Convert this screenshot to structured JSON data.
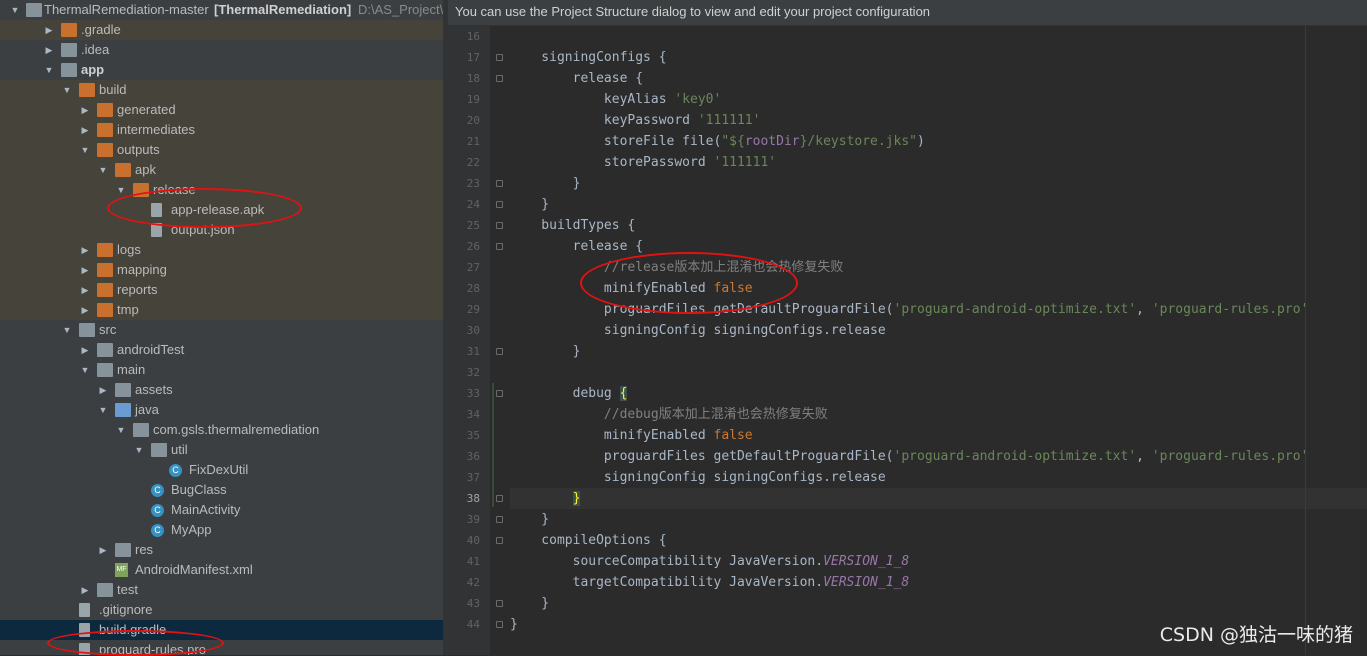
{
  "tree": {
    "root_label": "ThermalRemediation-master",
    "root_module": "[ThermalRemediation]",
    "root_path": "D:\\AS_Project\\F",
    "items": [
      {
        "label": "ThermalRemediation-master",
        "depth": 0,
        "arrow": "down",
        "icon": "folder-g"
      },
      {
        "label": ".gradle",
        "depth": 1,
        "arrow": "right",
        "icon": "folder-o"
      },
      {
        "label": ".idea",
        "depth": 1,
        "arrow": "right",
        "icon": "folder-g"
      },
      {
        "label": "app",
        "depth": 1,
        "arrow": "down",
        "icon": "folder-g",
        "bold": true
      },
      {
        "label": "build",
        "depth": 2,
        "arrow": "down",
        "icon": "folder-o"
      },
      {
        "label": "generated",
        "depth": 3,
        "arrow": "right",
        "icon": "folder-o"
      },
      {
        "label": "intermediates",
        "depth": 3,
        "arrow": "right",
        "icon": "folder-o"
      },
      {
        "label": "outputs",
        "depth": 3,
        "arrow": "down",
        "icon": "folder-o"
      },
      {
        "label": "apk",
        "depth": 4,
        "arrow": "down",
        "icon": "folder-o"
      },
      {
        "label": "release",
        "depth": 5,
        "arrow": "down",
        "icon": "folder-o"
      },
      {
        "label": "app-release.apk",
        "depth": 6,
        "arrow": "none",
        "icon": "file"
      },
      {
        "label": "output.json",
        "depth": 6,
        "arrow": "none",
        "icon": "file"
      },
      {
        "label": "logs",
        "depth": 3,
        "arrow": "right",
        "icon": "folder-o"
      },
      {
        "label": "mapping",
        "depth": 3,
        "arrow": "right",
        "icon": "folder-o"
      },
      {
        "label": "reports",
        "depth": 3,
        "arrow": "right",
        "icon": "folder-o"
      },
      {
        "label": "tmp",
        "depth": 3,
        "arrow": "right",
        "icon": "folder-o"
      },
      {
        "label": "src",
        "depth": 2,
        "arrow": "down",
        "icon": "folder-g"
      },
      {
        "label": "androidTest",
        "depth": 3,
        "arrow": "right",
        "icon": "folder-g"
      },
      {
        "label": "main",
        "depth": 3,
        "arrow": "down",
        "icon": "folder-g"
      },
      {
        "label": "assets",
        "depth": 4,
        "arrow": "right",
        "icon": "folder-g"
      },
      {
        "label": "java",
        "depth": 4,
        "arrow": "down",
        "icon": "folder-b"
      },
      {
        "label": "com.gsls.thermalremediation",
        "depth": 5,
        "arrow": "down",
        "icon": "folder-g"
      },
      {
        "label": "util",
        "depth": 6,
        "arrow": "down",
        "icon": "folder-g"
      },
      {
        "label": "FixDexUtil",
        "depth": 7,
        "arrow": "none",
        "icon": "class"
      },
      {
        "label": "BugClass",
        "depth": 6,
        "arrow": "none",
        "icon": "class"
      },
      {
        "label": "MainActivity",
        "depth": 6,
        "arrow": "none",
        "icon": "class"
      },
      {
        "label": "MyApp",
        "depth": 6,
        "arrow": "none",
        "icon": "class"
      },
      {
        "label": "res",
        "depth": 4,
        "arrow": "right",
        "icon": "folder-g"
      },
      {
        "label": "AndroidManifest.xml",
        "depth": 4,
        "arrow": "none",
        "icon": "xml"
      },
      {
        "label": "test",
        "depth": 3,
        "arrow": "right",
        "icon": "folder-g"
      },
      {
        "label": ".gitignore",
        "depth": 2,
        "arrow": "none",
        "icon": "file"
      },
      {
        "label": "build.gradle",
        "depth": 2,
        "arrow": "none",
        "icon": "file"
      },
      {
        "label": "proguard-rules.pro",
        "depth": 2,
        "arrow": "none",
        "icon": "file"
      }
    ]
  },
  "banner": "You can use the Project Structure dialog to view and edit your project configuration",
  "editor": {
    "current_line": 38,
    "lines": [
      {
        "n": 16,
        "segs": []
      },
      {
        "n": 17,
        "segs": [
          [
            "    signingConfigs {",
            ""
          ]
        ]
      },
      {
        "n": 18,
        "segs": [
          [
            "        release {",
            ""
          ]
        ]
      },
      {
        "n": 19,
        "segs": [
          [
            "            keyAlias ",
            ""
          ],
          [
            "'key0'",
            "str"
          ]
        ]
      },
      {
        "n": 20,
        "segs": [
          [
            "            keyPassword ",
            ""
          ],
          [
            "'111111'",
            "str"
          ]
        ]
      },
      {
        "n": 21,
        "segs": [
          [
            "            storeFile file(",
            ""
          ],
          [
            "\"${",
            "str"
          ],
          [
            "rootDir",
            "tpl"
          ],
          [
            "}/keystore.jks\"",
            "str"
          ],
          [
            ")",
            ""
          ]
        ]
      },
      {
        "n": 22,
        "segs": [
          [
            "            storePassword ",
            ""
          ],
          [
            "'111111'",
            "str"
          ]
        ]
      },
      {
        "n": 23,
        "segs": [
          [
            "        }",
            ""
          ]
        ]
      },
      {
        "n": 24,
        "segs": [
          [
            "    }",
            ""
          ]
        ]
      },
      {
        "n": 25,
        "segs": [
          [
            "    buildTypes {",
            ""
          ]
        ]
      },
      {
        "n": 26,
        "segs": [
          [
            "        release {",
            ""
          ]
        ]
      },
      {
        "n": 27,
        "segs": [
          [
            "            ",
            ""
          ],
          [
            "//release版本加上混淆也会热修复失败",
            "cmt"
          ]
        ]
      },
      {
        "n": 28,
        "segs": [
          [
            "            minifyEnabled ",
            ""
          ],
          [
            "false",
            "kw"
          ]
        ]
      },
      {
        "n": 29,
        "segs": [
          [
            "            proguardFiles getDefaultProguardFile(",
            ""
          ],
          [
            "'proguard-android-optimize.txt'",
            "str"
          ],
          [
            ", ",
            ""
          ],
          [
            "'proguard-rules.pro'",
            "str"
          ]
        ]
      },
      {
        "n": 30,
        "segs": [
          [
            "            signingConfig signingConfigs.release",
            ""
          ]
        ]
      },
      {
        "n": 31,
        "segs": [
          [
            "        }",
            ""
          ]
        ]
      },
      {
        "n": 32,
        "segs": []
      },
      {
        "n": 33,
        "segs": [
          [
            "        debug ",
            ""
          ],
          [
            "{",
            "brace-hl"
          ]
        ]
      },
      {
        "n": 34,
        "segs": [
          [
            "            ",
            ""
          ],
          [
            "//debug版本加上混淆也会热修复失败",
            "cmt"
          ]
        ]
      },
      {
        "n": 35,
        "segs": [
          [
            "            minifyEnabled ",
            ""
          ],
          [
            "false",
            "kw"
          ]
        ]
      },
      {
        "n": 36,
        "segs": [
          [
            "            proguardFiles getDefaultProguardFile(",
            ""
          ],
          [
            "'proguard-android-optimize.txt'",
            "str"
          ],
          [
            ", ",
            ""
          ],
          [
            "'proguard-rules.pro'",
            "str"
          ]
        ]
      },
      {
        "n": 37,
        "segs": [
          [
            "            signingConfig signingConfigs.release",
            ""
          ]
        ]
      },
      {
        "n": 38,
        "segs": [
          [
            "        ",
            ""
          ],
          [
            "}",
            "brace-hl"
          ]
        ]
      },
      {
        "n": 39,
        "segs": [
          [
            "    }",
            ""
          ]
        ]
      },
      {
        "n": 40,
        "segs": [
          [
            "    compileOptions {",
            ""
          ]
        ]
      },
      {
        "n": 41,
        "segs": [
          [
            "        sourceCompatibility JavaVersion.",
            ""
          ],
          [
            "VERSION_1_8",
            "it"
          ]
        ]
      },
      {
        "n": 42,
        "segs": [
          [
            "        targetCompatibility JavaVersion.",
            ""
          ],
          [
            "VERSION_1_8",
            "it"
          ]
        ]
      },
      {
        "n": 43,
        "segs": [
          [
            "    }",
            ""
          ]
        ]
      },
      {
        "n": 44,
        "segs": [
          [
            "}",
            ""
          ]
        ]
      }
    ]
  },
  "watermark": "CSDN @独沽一味的猪"
}
